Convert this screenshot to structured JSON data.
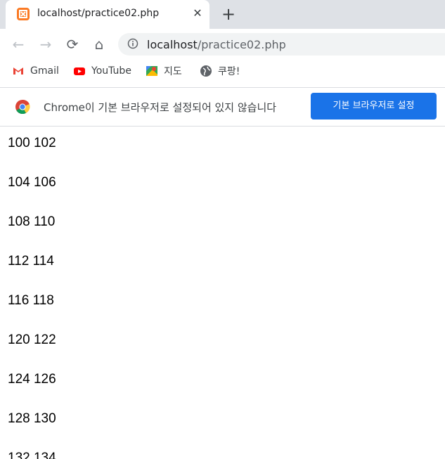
{
  "tab": {
    "title": "localhost/practice02.php",
    "close_glyph": "✕"
  },
  "new_tab_glyph": "+",
  "toolbar": {
    "back_glyph": "←",
    "forward_glyph": "→",
    "reload_glyph": "⟳",
    "home_glyph": "⌂",
    "url_host": "localhost",
    "url_path": "/practice02.php"
  },
  "bookmarks": [
    {
      "label": "Gmail",
      "icon": "gmail-icon"
    },
    {
      "label": "YouTube",
      "icon": "youtube-icon"
    },
    {
      "label": "지도",
      "icon": "maps-icon"
    },
    {
      "label": "쿠팡!",
      "icon": "globe-icon"
    }
  ],
  "infobar": {
    "message": "Chrome이 기본 브라우저로 설정되어 있지 않습니다",
    "button": "기본 브라우저로 설정"
  },
  "content": {
    "lines": [
      "100 102",
      "104 106",
      "108 110",
      "112 114",
      "116 118",
      "120 122",
      "124 126",
      "128 130",
      "132 134"
    ]
  },
  "colors": {
    "accent": "#1a73e8",
    "tabstrip": "#dee1e6",
    "omnibox": "#f1f3f4"
  }
}
